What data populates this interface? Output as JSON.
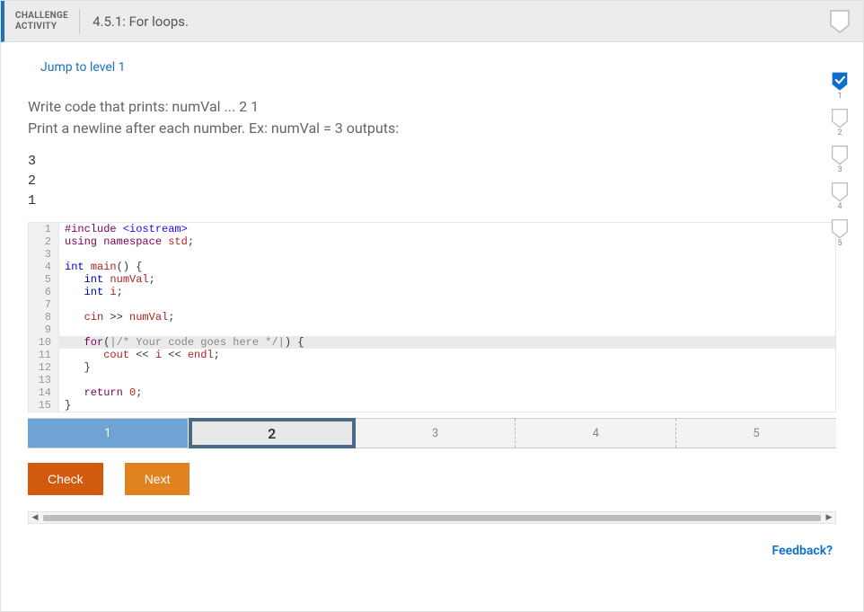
{
  "header": {
    "label_line1": "CHALLENGE",
    "label_line2": "ACTIVITY",
    "title": "4.5.1: For loops."
  },
  "jump_link": "Jump to level 1",
  "prompt_line1": "Write code that prints: numVal ... 2 1",
  "prompt_line2": "Print a newline after each number. Ex: numVal = 3 outputs:",
  "example_output": "3\n2\n1",
  "code_lines": [
    {
      "n": 1,
      "html": "<span class='kw-inc'>#include</span> <span class='str'>&lt;iostream&gt;</span>"
    },
    {
      "n": 2,
      "html": "<span class='kw-ns'>using</span> <span class='kw-ns'>namespace</span> <span class='id'>std</span>;"
    },
    {
      "n": 3,
      "html": ""
    },
    {
      "n": 4,
      "html": "<span class='kw-type'>int</span> <span class='id'>main</span>() {"
    },
    {
      "n": 5,
      "html": "   <span class='kw-type'>int</span> <span class='id'>numVal</span>;"
    },
    {
      "n": 6,
      "html": "   <span class='kw-type'>int</span> <span class='id'>i</span>;"
    },
    {
      "n": 7,
      "html": ""
    },
    {
      "n": 8,
      "html": "   <span class='id'>cin</span> &gt;&gt; <span class='id'>numVal</span>;"
    },
    {
      "n": 9,
      "html": ""
    },
    {
      "n": 10,
      "html": "   <span class='kw-ctrl'>for</span>(<span class='cmt'>|/* Your code goes here */|</span>) {",
      "hl": true
    },
    {
      "n": 11,
      "html": "      <span class='id'>cout</span> &lt;&lt; <span class='id'>i</span> &lt;&lt; <span class='id'>endl</span>;"
    },
    {
      "n": 12,
      "html": "   }"
    },
    {
      "n": 13,
      "html": ""
    },
    {
      "n": 14,
      "html": "   <span class='kw-ctrl'>return</span> <span class='num'>0</span>;"
    },
    {
      "n": 15,
      "html": "}"
    }
  ],
  "levels": [
    {
      "label": "1",
      "state": "done"
    },
    {
      "label": "2",
      "state": "active"
    },
    {
      "label": "3",
      "state": ""
    },
    {
      "label": "4",
      "state": ""
    },
    {
      "label": "5",
      "state": ""
    }
  ],
  "buttons": {
    "check": "Check",
    "next": "Next"
  },
  "feedback": "Feedback?",
  "side_badges": [
    {
      "n": "1",
      "done": true
    },
    {
      "n": "2",
      "done": false
    },
    {
      "n": "3",
      "done": false
    },
    {
      "n": "4",
      "done": false
    },
    {
      "n": "5",
      "done": false
    }
  ]
}
